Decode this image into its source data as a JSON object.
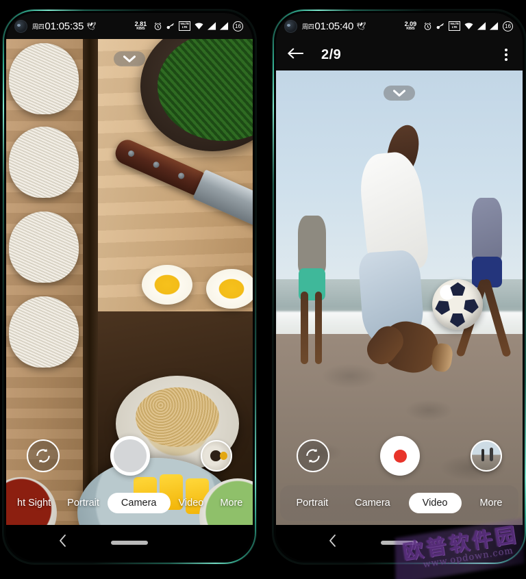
{
  "background_color": "#000000",
  "frame_color": "#2fa98c",
  "phones": [
    {
      "id": "left",
      "status_bar": {
        "day": "周四",
        "clock": "01:05:35",
        "net_speed_value": "2.81",
        "net_speed_unit": "KB/S",
        "icons": [
          "alarm-icon",
          "key-icon",
          "volte-icon",
          "wifi-icon",
          "signal-icon",
          "signal-icon"
        ],
        "volte_top": "VoLTE",
        "volte_bottom": "LTE",
        "battery_level": "16"
      },
      "viewfinder": {
        "photo_description": "overhead food flat-lay with noodles, knife, spinach, eggs",
        "expand_icon": "chevron-down-icon"
      },
      "controls": {
        "flip_icon": "camera-flip-icon",
        "shutter_type": "photo",
        "thumbnail": "gallery-thumbnail-spices"
      },
      "modes": [
        {
          "label": "ht Sight",
          "active": false
        },
        {
          "label": "Portrait",
          "active": false
        },
        {
          "label": "Camera",
          "active": true
        },
        {
          "label": "Video",
          "active": false
        },
        {
          "label": "More",
          "active": false
        }
      ],
      "nav_bar": {
        "back_icon": "chevron-left-icon",
        "home_indicator": "home-pill"
      }
    },
    {
      "id": "right",
      "status_bar": {
        "day": "周四",
        "clock": "01:05:40",
        "net_speed_value": "2.09",
        "net_speed_unit": "KB/S",
        "icons": [
          "alarm-icon",
          "key-icon",
          "volte-icon",
          "wifi-icon",
          "signal-icon",
          "signal-icon"
        ],
        "volte_top": "VoLTE",
        "volte_bottom": "LTE",
        "battery_level": "16"
      },
      "app_bar": {
        "back_icon": "arrow-left-icon",
        "title": "2/9",
        "menu_icon": "kebab-menu-icon"
      },
      "viewfinder": {
        "photo_description": "beach football players kicking a soccer ball at the shoreline",
        "expand_icon": "chevron-down-icon"
      },
      "controls": {
        "flip_icon": "camera-flip-icon",
        "shutter_type": "video",
        "thumbnail": "gallery-thumbnail-beach"
      },
      "modes": [
        {
          "label": "Portrait",
          "active": false
        },
        {
          "label": "Camera",
          "active": false
        },
        {
          "label": "Video",
          "active": true
        },
        {
          "label": "More",
          "active": false
        }
      ],
      "nav_bar": {
        "back_icon": "chevron-left-icon",
        "home_indicator": "home-pill"
      }
    }
  ],
  "watermark": {
    "text_cn": "欧普软件园",
    "url": "www.opdown.com",
    "color": "#5b2f80"
  }
}
